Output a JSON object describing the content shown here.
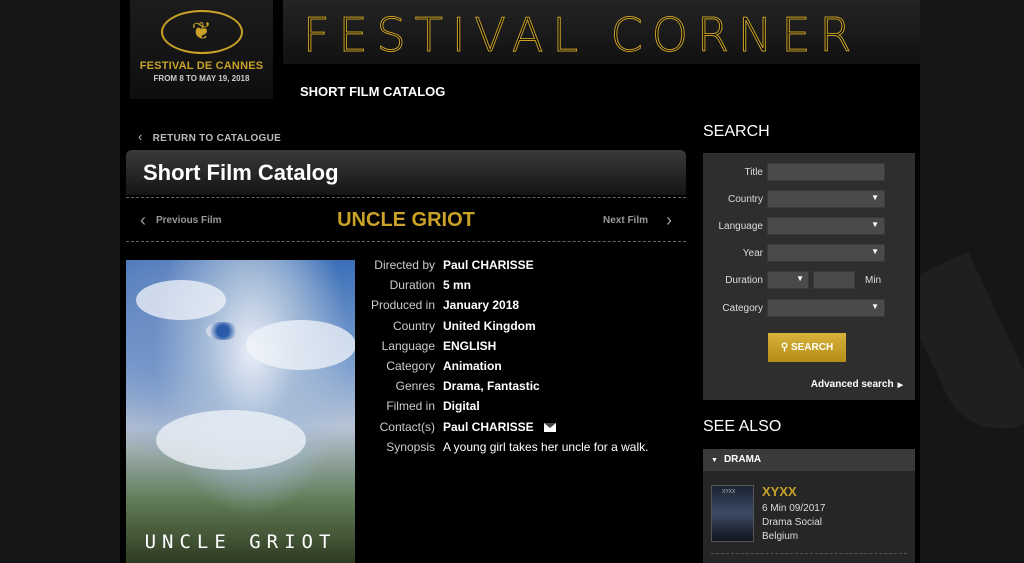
{
  "header": {
    "festival_name": "FESTIVAL DE CANNES",
    "festival_dates": "FROM 8 TO MAY 19, 2018",
    "brand": "FESTIVAL CORNER",
    "section_title": "SHORT FILM CATALOG",
    "accent_color": "#c9a227"
  },
  "main": {
    "back_link": "RETURN TO CATALOGUE",
    "catalog_title": "Short Film Catalog",
    "nav": {
      "previous": "Previous Film",
      "next": "Next Film",
      "film_title": "UNCLE GRIOT"
    },
    "poster_title": "UNCLE GRIOT",
    "details": [
      {
        "label": "Directed by",
        "value": "Paul CHARISSE"
      },
      {
        "label": "Duration",
        "value": "5 mn"
      },
      {
        "label": "Produced in",
        "value": "January 2018"
      },
      {
        "label": "Country",
        "value": "United Kingdom"
      },
      {
        "label": "Language",
        "value": "ENGLISH"
      },
      {
        "label": "Category",
        "value": "Animation"
      },
      {
        "label": "Genres",
        "value": "Drama, Fantastic"
      },
      {
        "label": "Filmed in",
        "value": "Digital"
      },
      {
        "label": "Contact(s)",
        "value": "Paul CHARISSE"
      },
      {
        "label": "Synopsis",
        "value": "A young girl takes her uncle for a walk."
      }
    ]
  },
  "sidebar": {
    "search_heading": "SEARCH",
    "fields": {
      "title": "Title",
      "country": "Country",
      "language": "Language",
      "year": "Year",
      "duration": "Duration",
      "duration_unit": "Min",
      "category": "Category"
    },
    "search_button": "SEARCH",
    "advanced_search": "Advanced search",
    "see_also_heading": "SEE ALSO",
    "see_also_tab": "DRAMA",
    "see_also_item": {
      "thumb_text": "XYXX",
      "title": "XYXX",
      "line1": "6 Min 09/2017",
      "line2": "Drama Social",
      "line3": "Belgium"
    }
  }
}
